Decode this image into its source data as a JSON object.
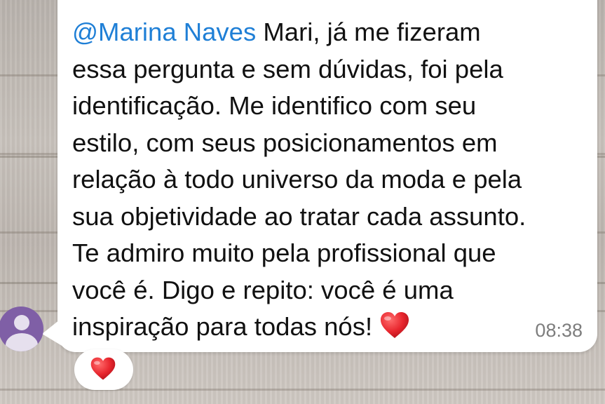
{
  "message": {
    "mention": "@Marina Naves",
    "text_lines": [
      " Mari, já me fizeram",
      "essa pergunta e sem dúvidas, foi pela",
      "identificação. Me identifico com seu",
      "estilo, com seus posicionamentos em",
      "relação à todo universo da moda e pela",
      "sua objetividade ao tratar cada assunto.",
      "Te admiro muito pela profissional que",
      "você é. Digo e repito: você é uma",
      "inspiração para todas nós! "
    ],
    "emoji": "heart-emoji",
    "time": "08:38"
  },
  "reaction": {
    "emoji": "heart-emoji"
  },
  "avatar": {
    "icon": "default-user-avatar-icon",
    "color": "#7f5fa6"
  },
  "colors": {
    "mention": "#1f7fd6",
    "bubble": "#ffffff",
    "heart": "#e8262e"
  }
}
